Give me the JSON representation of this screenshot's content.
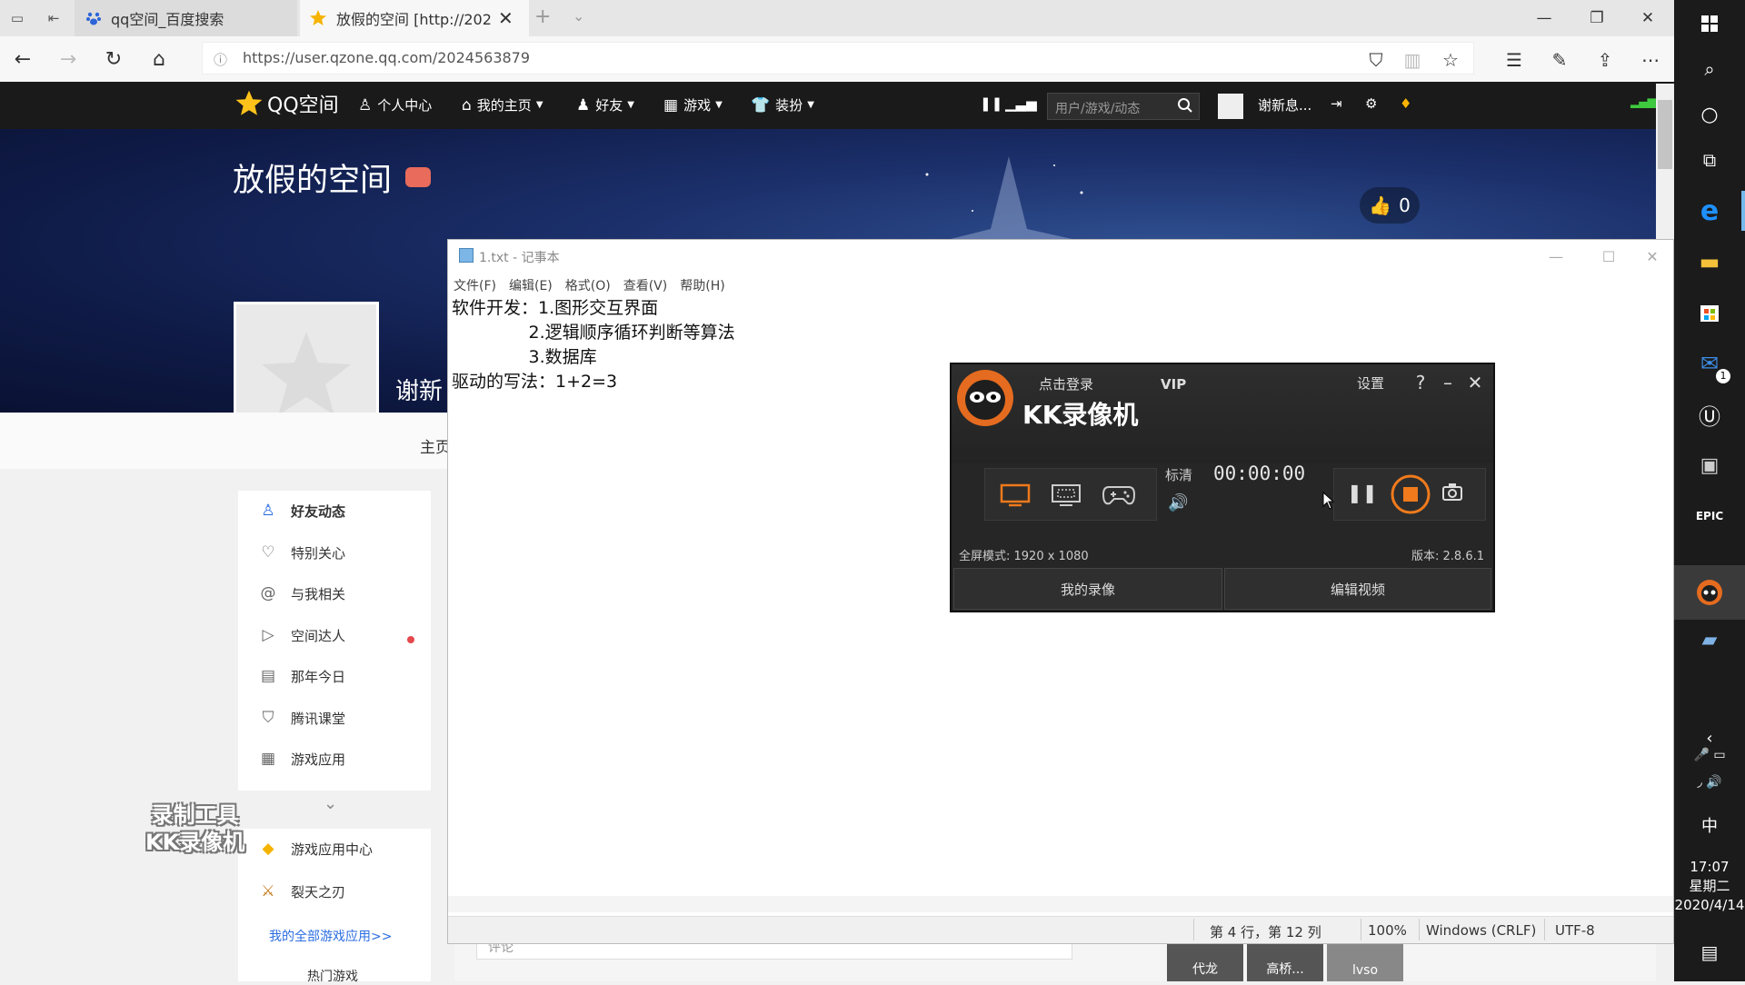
{
  "browser": {
    "tabs": [
      {
        "label": "qq空间_百度搜索",
        "icon": "paw-icon"
      },
      {
        "label": "放假的空间 [http://2024",
        "icon": "star-icon"
      }
    ],
    "url": "https://user.qzone.qq.com/2024563879"
  },
  "qzone": {
    "logo_text": "QQ空间",
    "nav": [
      {
        "label": "个人中心",
        "icon": "user-icon"
      },
      {
        "label": "我的主页",
        "icon": "house-icon"
      },
      {
        "label": "好友",
        "icon": "friends-icon"
      },
      {
        "label": "游戏",
        "icon": "grid-icon"
      },
      {
        "label": "装扮",
        "icon": "shirt-icon"
      }
    ],
    "search_placeholder": "用户/游戏/动态",
    "user_short": "谢新息...",
    "space_title": "放假的空间",
    "like_count": "0",
    "username_partial": "谢新",
    "home_link": "主页",
    "left_menu": [
      {
        "label": "好友动态",
        "icon": "person-icon"
      },
      {
        "label": "特别关心",
        "icon": "heart-icon"
      },
      {
        "label": "与我相关",
        "icon": "at-icon"
      },
      {
        "label": "空间达人",
        "icon": "play-circle-icon"
      },
      {
        "label": "那年今日",
        "icon": "calendar-icon"
      },
      {
        "label": "腾讯课堂",
        "icon": "graduation-icon"
      },
      {
        "label": "游戏应用",
        "icon": "apps-icon"
      }
    ],
    "game_items": [
      {
        "label": "游戏应用中心",
        "icon": "game-center-icon"
      },
      {
        "label": "裂天之刃",
        "icon": "blade-icon"
      }
    ],
    "game_all_link": "我的全部游戏应用>>",
    "hot_games": "热门游戏",
    "comment_placeholder": "评论",
    "thumbs": [
      "代龙",
      "高桥...",
      "lvso"
    ]
  },
  "watermark": {
    "line1": "录制工具",
    "line2": "KK录像机"
  },
  "notepad": {
    "title": "1.txt - 记事本",
    "menu": [
      "文件(F)",
      "编辑(E)",
      "格式(O)",
      "查看(V)",
      "帮助(H)"
    ],
    "content": "软件开发：1.图形交互界面\n              2.逻辑顺序循环判断等算法\n              3.数据库\n驱动的写法：1+2=3",
    "status": {
      "position": "第 4 行，第 12 列",
      "zoom": "100%",
      "line_ending": "Windows (CRLF)",
      "encoding": "UTF-8"
    }
  },
  "kk_recorder": {
    "login": "点击登录",
    "vip": "VIP",
    "brand": "KK录像机",
    "settings": "设置",
    "quality": "标清",
    "timer": "00:00:00",
    "mode_line": "全屏模式: 1920 x 1080",
    "version": "版本: 2.8.6.1",
    "my_recordings": "我的录像",
    "edit_video": "编辑视频",
    "accent_color": "#f07a1c"
  },
  "taskbar": {
    "lang": "中",
    "time": "17:07",
    "weekday": "星期二",
    "date": "2020/4/14",
    "mail_badge": "1"
  }
}
